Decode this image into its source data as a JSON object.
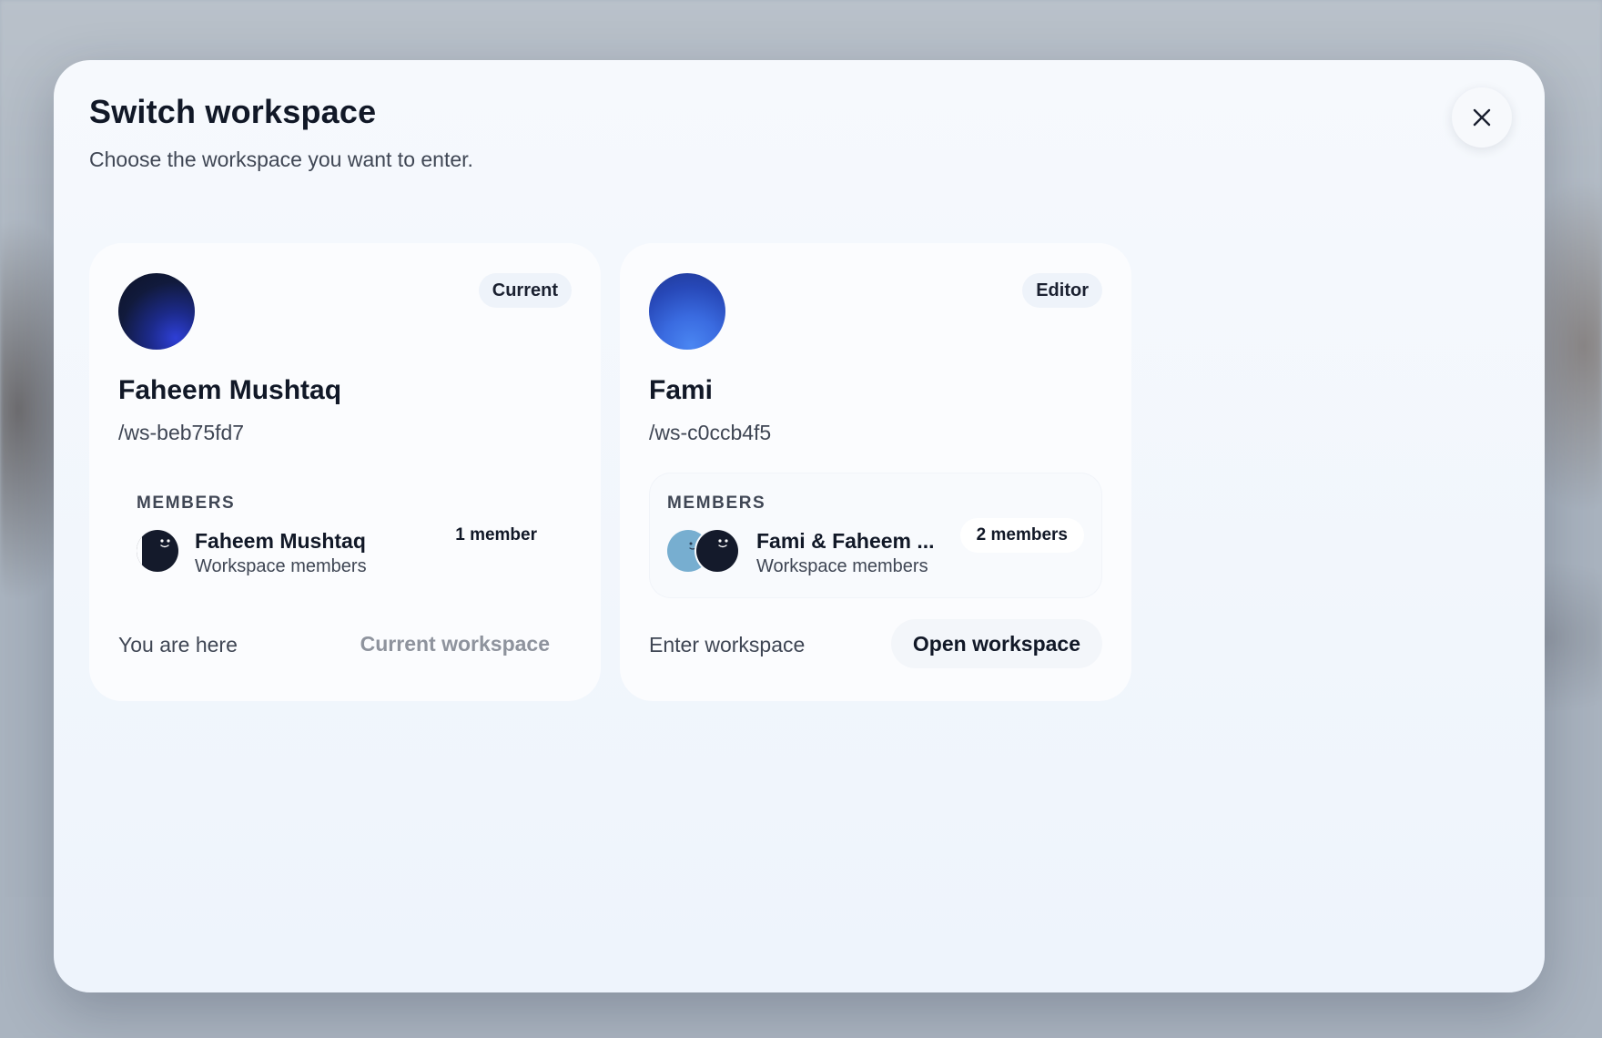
{
  "dialog": {
    "title": "Switch workspace",
    "subtitle": "Choose the workspace you want to enter.",
    "close_icon": "close-icon"
  },
  "workspaces": [
    {
      "name": "Faheem Mushtaq",
      "slug": "/ws-beb75fd7",
      "badge": "Current",
      "members_label": "MEMBERS",
      "members_name": "Faheem Mushtaq",
      "members_sub": "Workspace members",
      "members_count": "1 member",
      "footer_text": "You are here",
      "action_label": "Current workspace",
      "avatar_colors": [
        "#111a3c",
        "#2e3fd6"
      ]
    },
    {
      "name": "Fami",
      "slug": "/ws-c0ccb4f5",
      "badge": "Editor",
      "members_label": "MEMBERS",
      "members_name": "Fami & Faheem ...",
      "members_sub": "Workspace members",
      "members_count": "2 members",
      "footer_text": "Enter workspace",
      "action_label": "Open workspace",
      "avatar_colors": [
        "#1f3894",
        "#4a86f2"
      ]
    }
  ],
  "colors": {
    "text_primary": "#111827",
    "text_secondary": "#3f4654",
    "text_disabled": "#8e939d",
    "modal_bg": "#f4f8fd"
  }
}
